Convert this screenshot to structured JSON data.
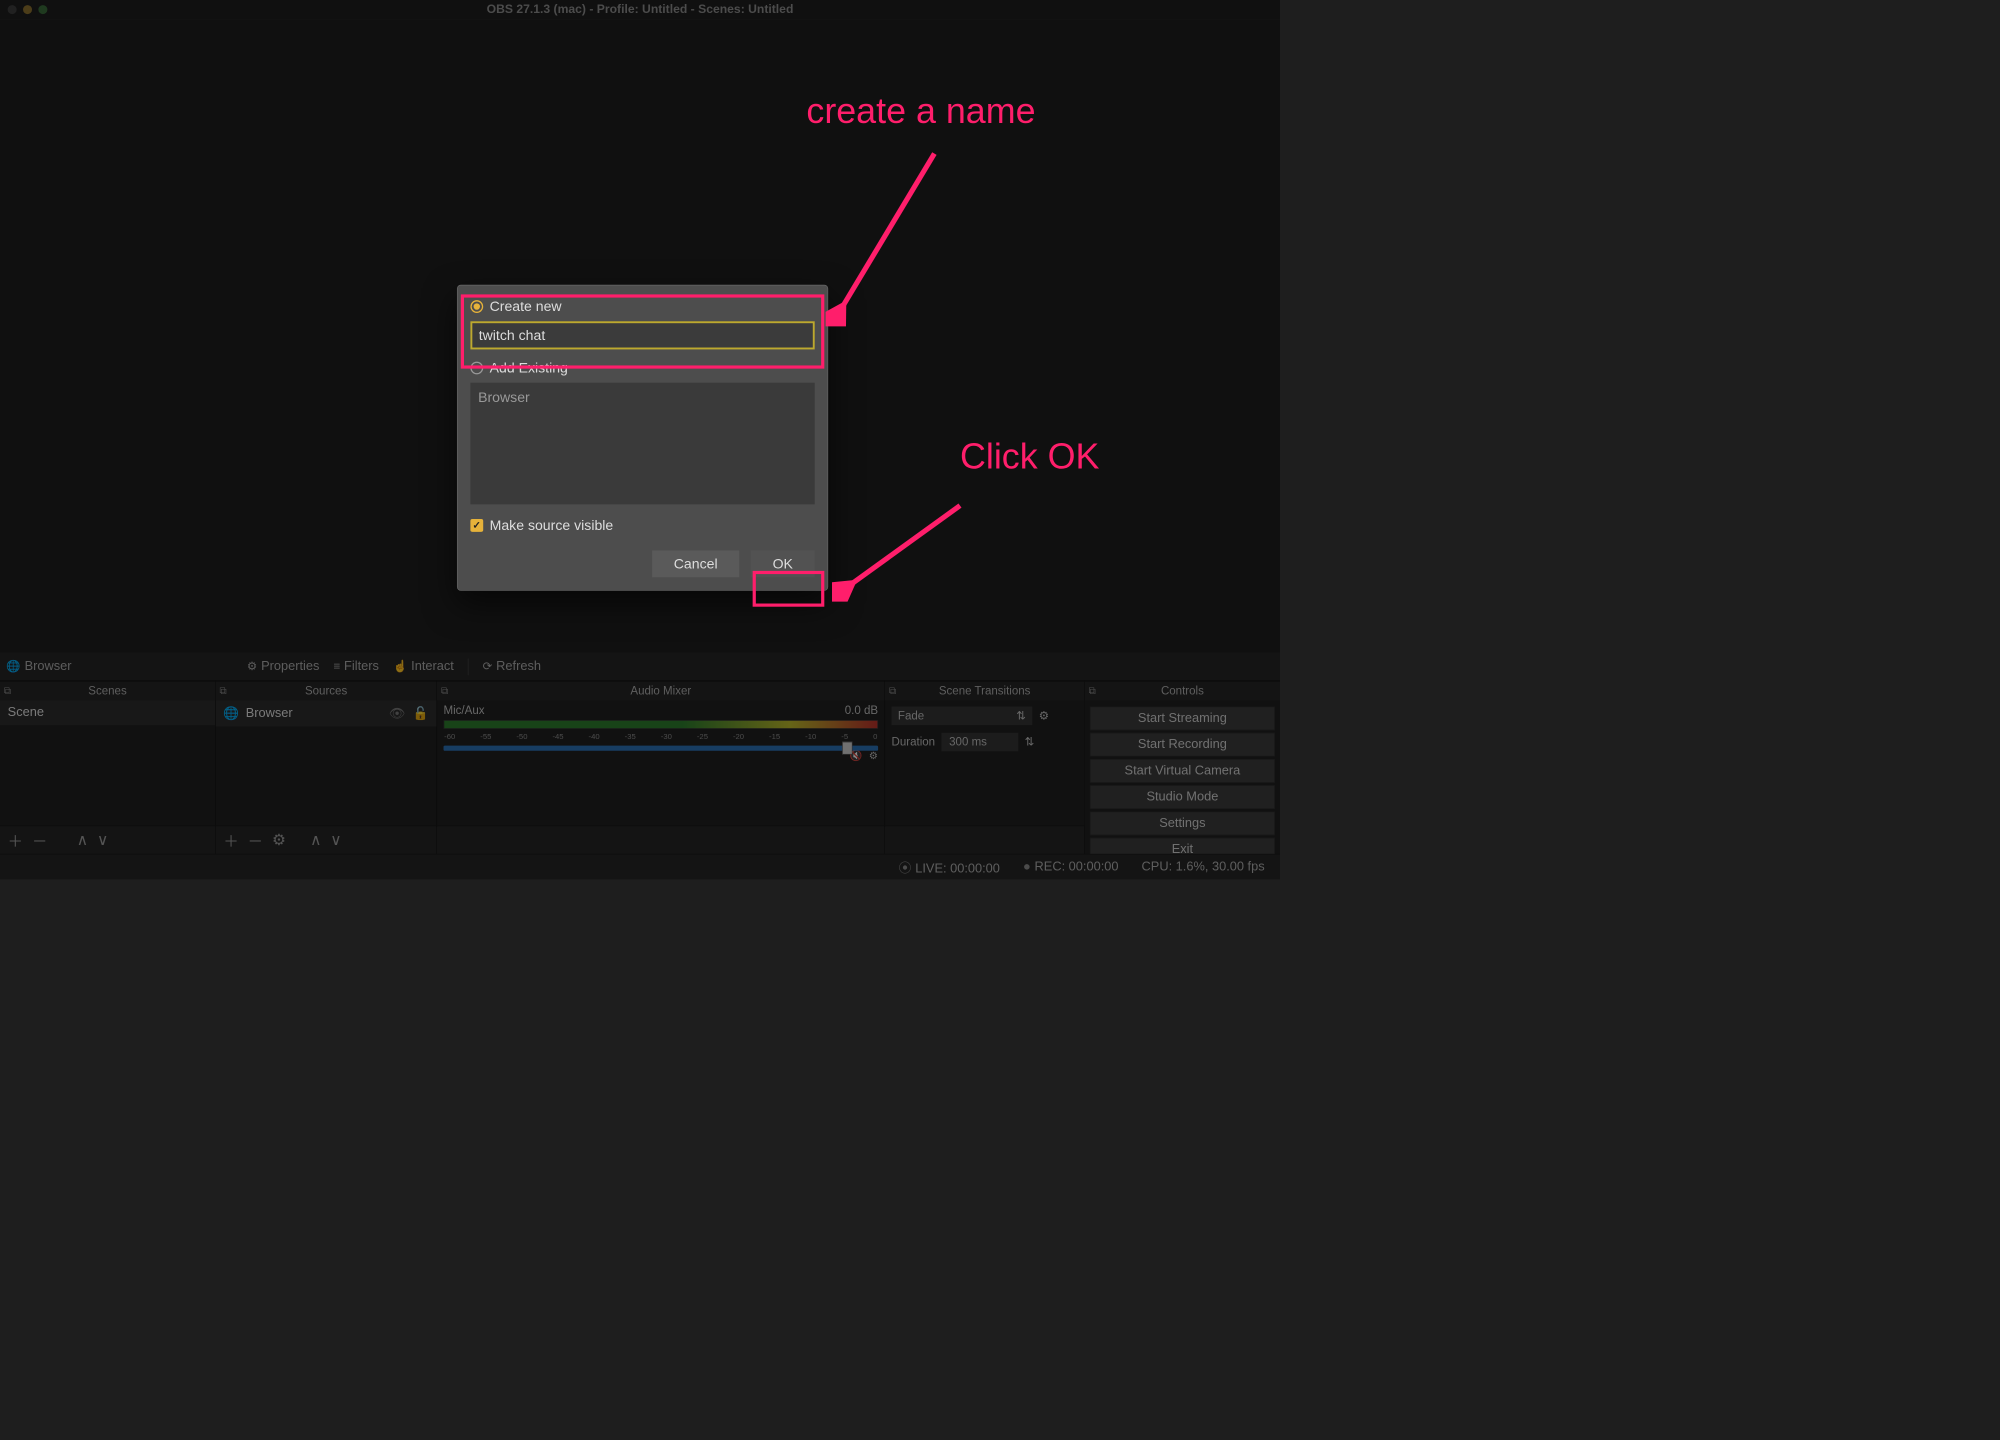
{
  "title": "OBS 27.1.3 (mac) - Profile: Untitled - Scenes: Untitled",
  "toolbar": {
    "preview_source": "Browser",
    "properties": "Properties",
    "filters": "Filters",
    "interact": "Interact",
    "refresh": "Refresh"
  },
  "panels": {
    "scenes": {
      "title": "Scenes",
      "items": [
        "Scene"
      ]
    },
    "sources": {
      "title": "Sources",
      "items": [
        "Browser"
      ]
    },
    "mixer": {
      "title": "Audio Mixer",
      "channel": "Mic/Aux",
      "db": "0.0 dB",
      "ticks": [
        "-60",
        "-55",
        "-50",
        "-45",
        "-40",
        "-35",
        "-30",
        "-25",
        "-20",
        "-15",
        "-10",
        "-5",
        "0"
      ]
    },
    "transitions": {
      "title": "Scene Transitions",
      "mode": "Fade",
      "duration_label": "Duration",
      "duration": "300 ms"
    },
    "controls": {
      "title": "Controls",
      "buttons": [
        "Start Streaming",
        "Start Recording",
        "Start Virtual Camera",
        "Studio Mode",
        "Settings",
        "Exit"
      ]
    }
  },
  "status": {
    "live": "LIVE: 00:00:00",
    "rec": "REC: 00:00:00",
    "cpu": "CPU: 1.6%, 30.00 fps"
  },
  "modal": {
    "create_new": "Create new",
    "name_value": "twitch chat",
    "add_existing": "Add Existing",
    "existing_item": "Browser",
    "visible": "Make source visible",
    "cancel": "Cancel",
    "ok": "OK"
  },
  "annotations": {
    "a1": "create a name",
    "a2": "Click OK"
  }
}
